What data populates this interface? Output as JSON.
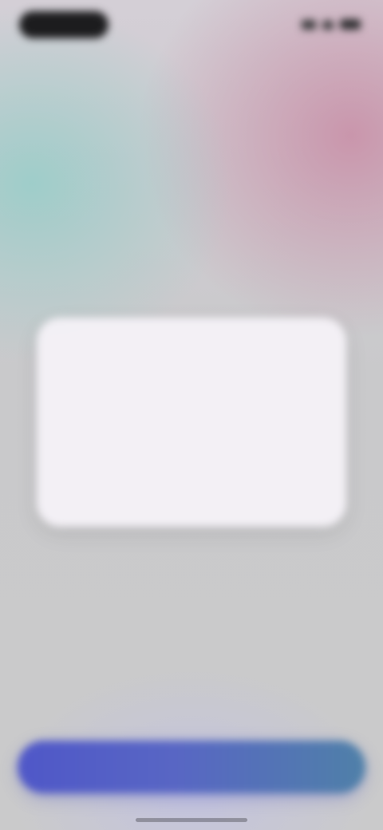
{
  "status_bar": {
    "pill_icon": "dynamic-island",
    "signal_icon": "cellular-signal-icon",
    "wifi_icon": "wifi-icon",
    "battery_icon": "battery-icon"
  },
  "header": {
    "title": "",
    "subtitle": ""
  },
  "card": {
    "heading": "",
    "body": "",
    "footer_text": "",
    "footer_link": ""
  },
  "footer": {
    "note": "",
    "cta_label": ""
  },
  "colors": {
    "cta_start": "#4f57c8",
    "cta_end": "#4f80a8",
    "background": "#cacacb"
  }
}
